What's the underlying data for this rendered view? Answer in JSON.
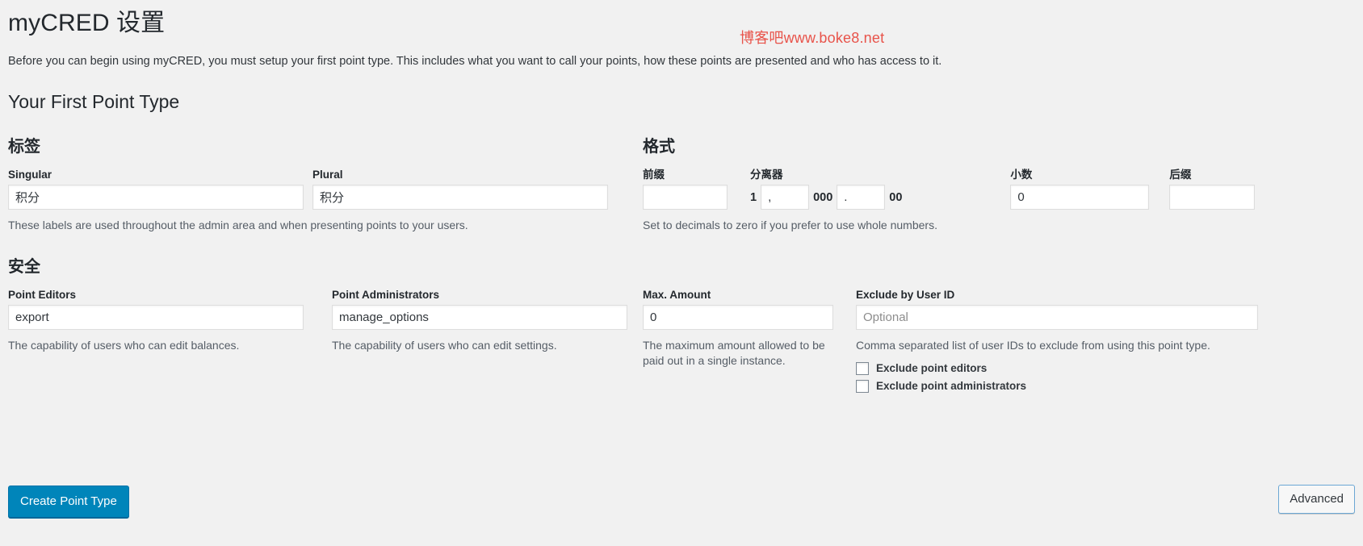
{
  "page": {
    "title": "myCRED 设置",
    "intro": "Before you can begin using myCRED, you must setup your first point type. This includes what you want to call your points, how these points are presented and who has access to it.",
    "section_title": "Your First Point Type",
    "watermark": "博客吧www.boke8.net",
    "watermark_color": "#e8534a",
    "accent_color": "#0085ba"
  },
  "labels": {
    "group_title": "标签",
    "singular": {
      "label": "Singular",
      "value": "积分",
      "placeholder": ""
    },
    "plural": {
      "label": "Plural",
      "value": "积分",
      "placeholder": ""
    },
    "description": "These labels are used throughout the admin area and when presenting points to your users."
  },
  "format": {
    "group_title": "格式",
    "prefix": {
      "label": "前缀",
      "value": "",
      "placeholder": ""
    },
    "separator": {
      "label": "分离器",
      "literal_1": "1",
      "thousands_value": ",",
      "literal_000": "000",
      "decimal_value": ".",
      "literal_00": "00"
    },
    "decimals": {
      "label": "小数",
      "value": "0",
      "placeholder": ""
    },
    "suffix": {
      "label": "后缀",
      "value": "",
      "placeholder": ""
    },
    "description": "Set to decimals to zero if you prefer to use whole numbers."
  },
  "security": {
    "group_title": "安全",
    "point_editors": {
      "label": "Point Editors",
      "value": "export",
      "placeholder": "",
      "description": "The capability of users who can edit balances."
    },
    "point_administrators": {
      "label": "Point Administrators",
      "value": "manage_options",
      "placeholder": "",
      "description": "The capability of users who can edit settings."
    },
    "max_amount": {
      "label": "Max. Amount",
      "value": "0",
      "placeholder": "",
      "description": "The maximum amount allowed to be paid out in a single instance."
    },
    "exclude_by_user_id": {
      "label": "Exclude by User ID",
      "value": "",
      "placeholder": "Optional",
      "description": "Comma separated list of user IDs to exclude from using this point type."
    },
    "checkboxes": [
      {
        "label": "Exclude point editors",
        "checked": false
      },
      {
        "label": "Exclude point administrators",
        "checked": false
      }
    ]
  },
  "footer": {
    "create_button": "Create Point Type",
    "advanced_button": "Advanced"
  }
}
